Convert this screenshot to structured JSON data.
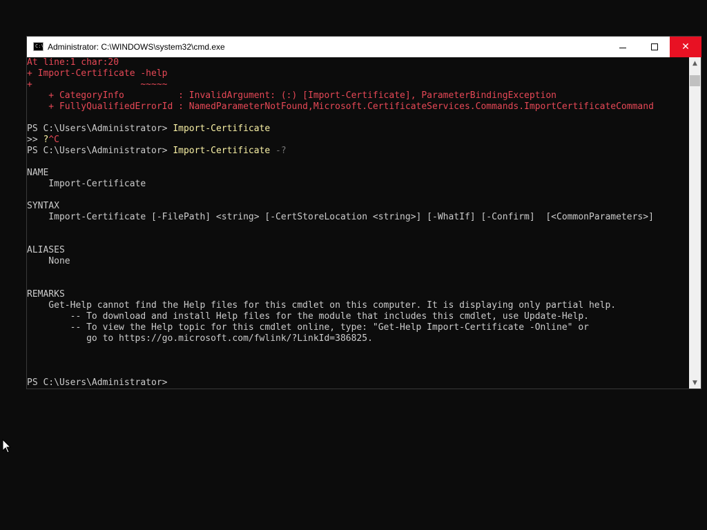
{
  "window": {
    "title": "Administrator: C:\\WINDOWS\\system32\\cmd.exe",
    "icon_text": "C:\\",
    "minimize_icon": "minimize-icon",
    "maximize_icon": "maximize-icon",
    "close_icon": "close-icon",
    "close_glyph": "✕"
  },
  "console": {
    "lines": [
      {
        "text": "At line:1 char:20",
        "style": "err"
      },
      {
        "text": "+ Import-Certificate -help",
        "style": "err"
      },
      {
        "text": "+                    ~~~~~",
        "style": "err"
      },
      {
        "text": "    + CategoryInfo          : InvalidArgument: (:) [Import-Certificate], ParameterBindingException",
        "style": "err"
      },
      {
        "text": "    + FullyQualifiedErrorId : NamedParameterNotFound,Microsoft.CertificateServices.Commands.ImportCertificateCommand",
        "style": "err"
      },
      {
        "text": "",
        "style": "plain"
      },
      {
        "prompt": "PS C:\\Users\\Administrator> ",
        "cmd": "Import-Certificate",
        "arg": "",
        "style": "prompt"
      },
      {
        "prompt": ">> ",
        "cmd": "?",
        "arg": "^C",
        "style": "prompt-err"
      },
      {
        "prompt": "PS C:\\Users\\Administrator> ",
        "cmd": "Import-Certificate",
        "arg": " -?",
        "style": "prompt-dim"
      },
      {
        "text": "",
        "style": "plain"
      },
      {
        "text": "NAME",
        "style": "plain"
      },
      {
        "text": "    Import-Certificate",
        "style": "plain"
      },
      {
        "text": "",
        "style": "plain"
      },
      {
        "text": "SYNTAX",
        "style": "plain"
      },
      {
        "text": "    Import-Certificate [-FilePath] <string> [-CertStoreLocation <string>] [-WhatIf] [-Confirm]  [<CommonParameters>]",
        "style": "plain"
      },
      {
        "text": "",
        "style": "plain"
      },
      {
        "text": "",
        "style": "plain"
      },
      {
        "text": "ALIASES",
        "style": "plain"
      },
      {
        "text": "    None",
        "style": "plain"
      },
      {
        "text": "",
        "style": "plain"
      },
      {
        "text": "",
        "style": "plain"
      },
      {
        "text": "REMARKS",
        "style": "plain"
      },
      {
        "text": "    Get-Help cannot find the Help files for this cmdlet on this computer. It is displaying only partial help.",
        "style": "plain"
      },
      {
        "text": "        -- To download and install Help files for the module that includes this cmdlet, use Update-Help.",
        "style": "plain"
      },
      {
        "text": "        -- To view the Help topic for this cmdlet online, type: \"Get-Help Import-Certificate -Online\" or",
        "style": "plain"
      },
      {
        "text": "           go to https://go.microsoft.com/fwlink/?LinkId=386825.",
        "style": "plain"
      },
      {
        "text": "",
        "style": "plain"
      },
      {
        "text": "",
        "style": "plain"
      },
      {
        "text": "",
        "style": "plain"
      },
      {
        "prompt": "PS C:\\Users\\Administrator> ",
        "cmd": "",
        "arg": "",
        "style": "prompt"
      }
    ]
  },
  "colors": {
    "error": "#e74856",
    "command": "#f9f1a5",
    "text": "#cccccc",
    "background": "#0c0c0c",
    "close_button": "#e81123"
  },
  "scrollbar": {
    "up_glyph": "▲",
    "down_glyph": "▼"
  }
}
